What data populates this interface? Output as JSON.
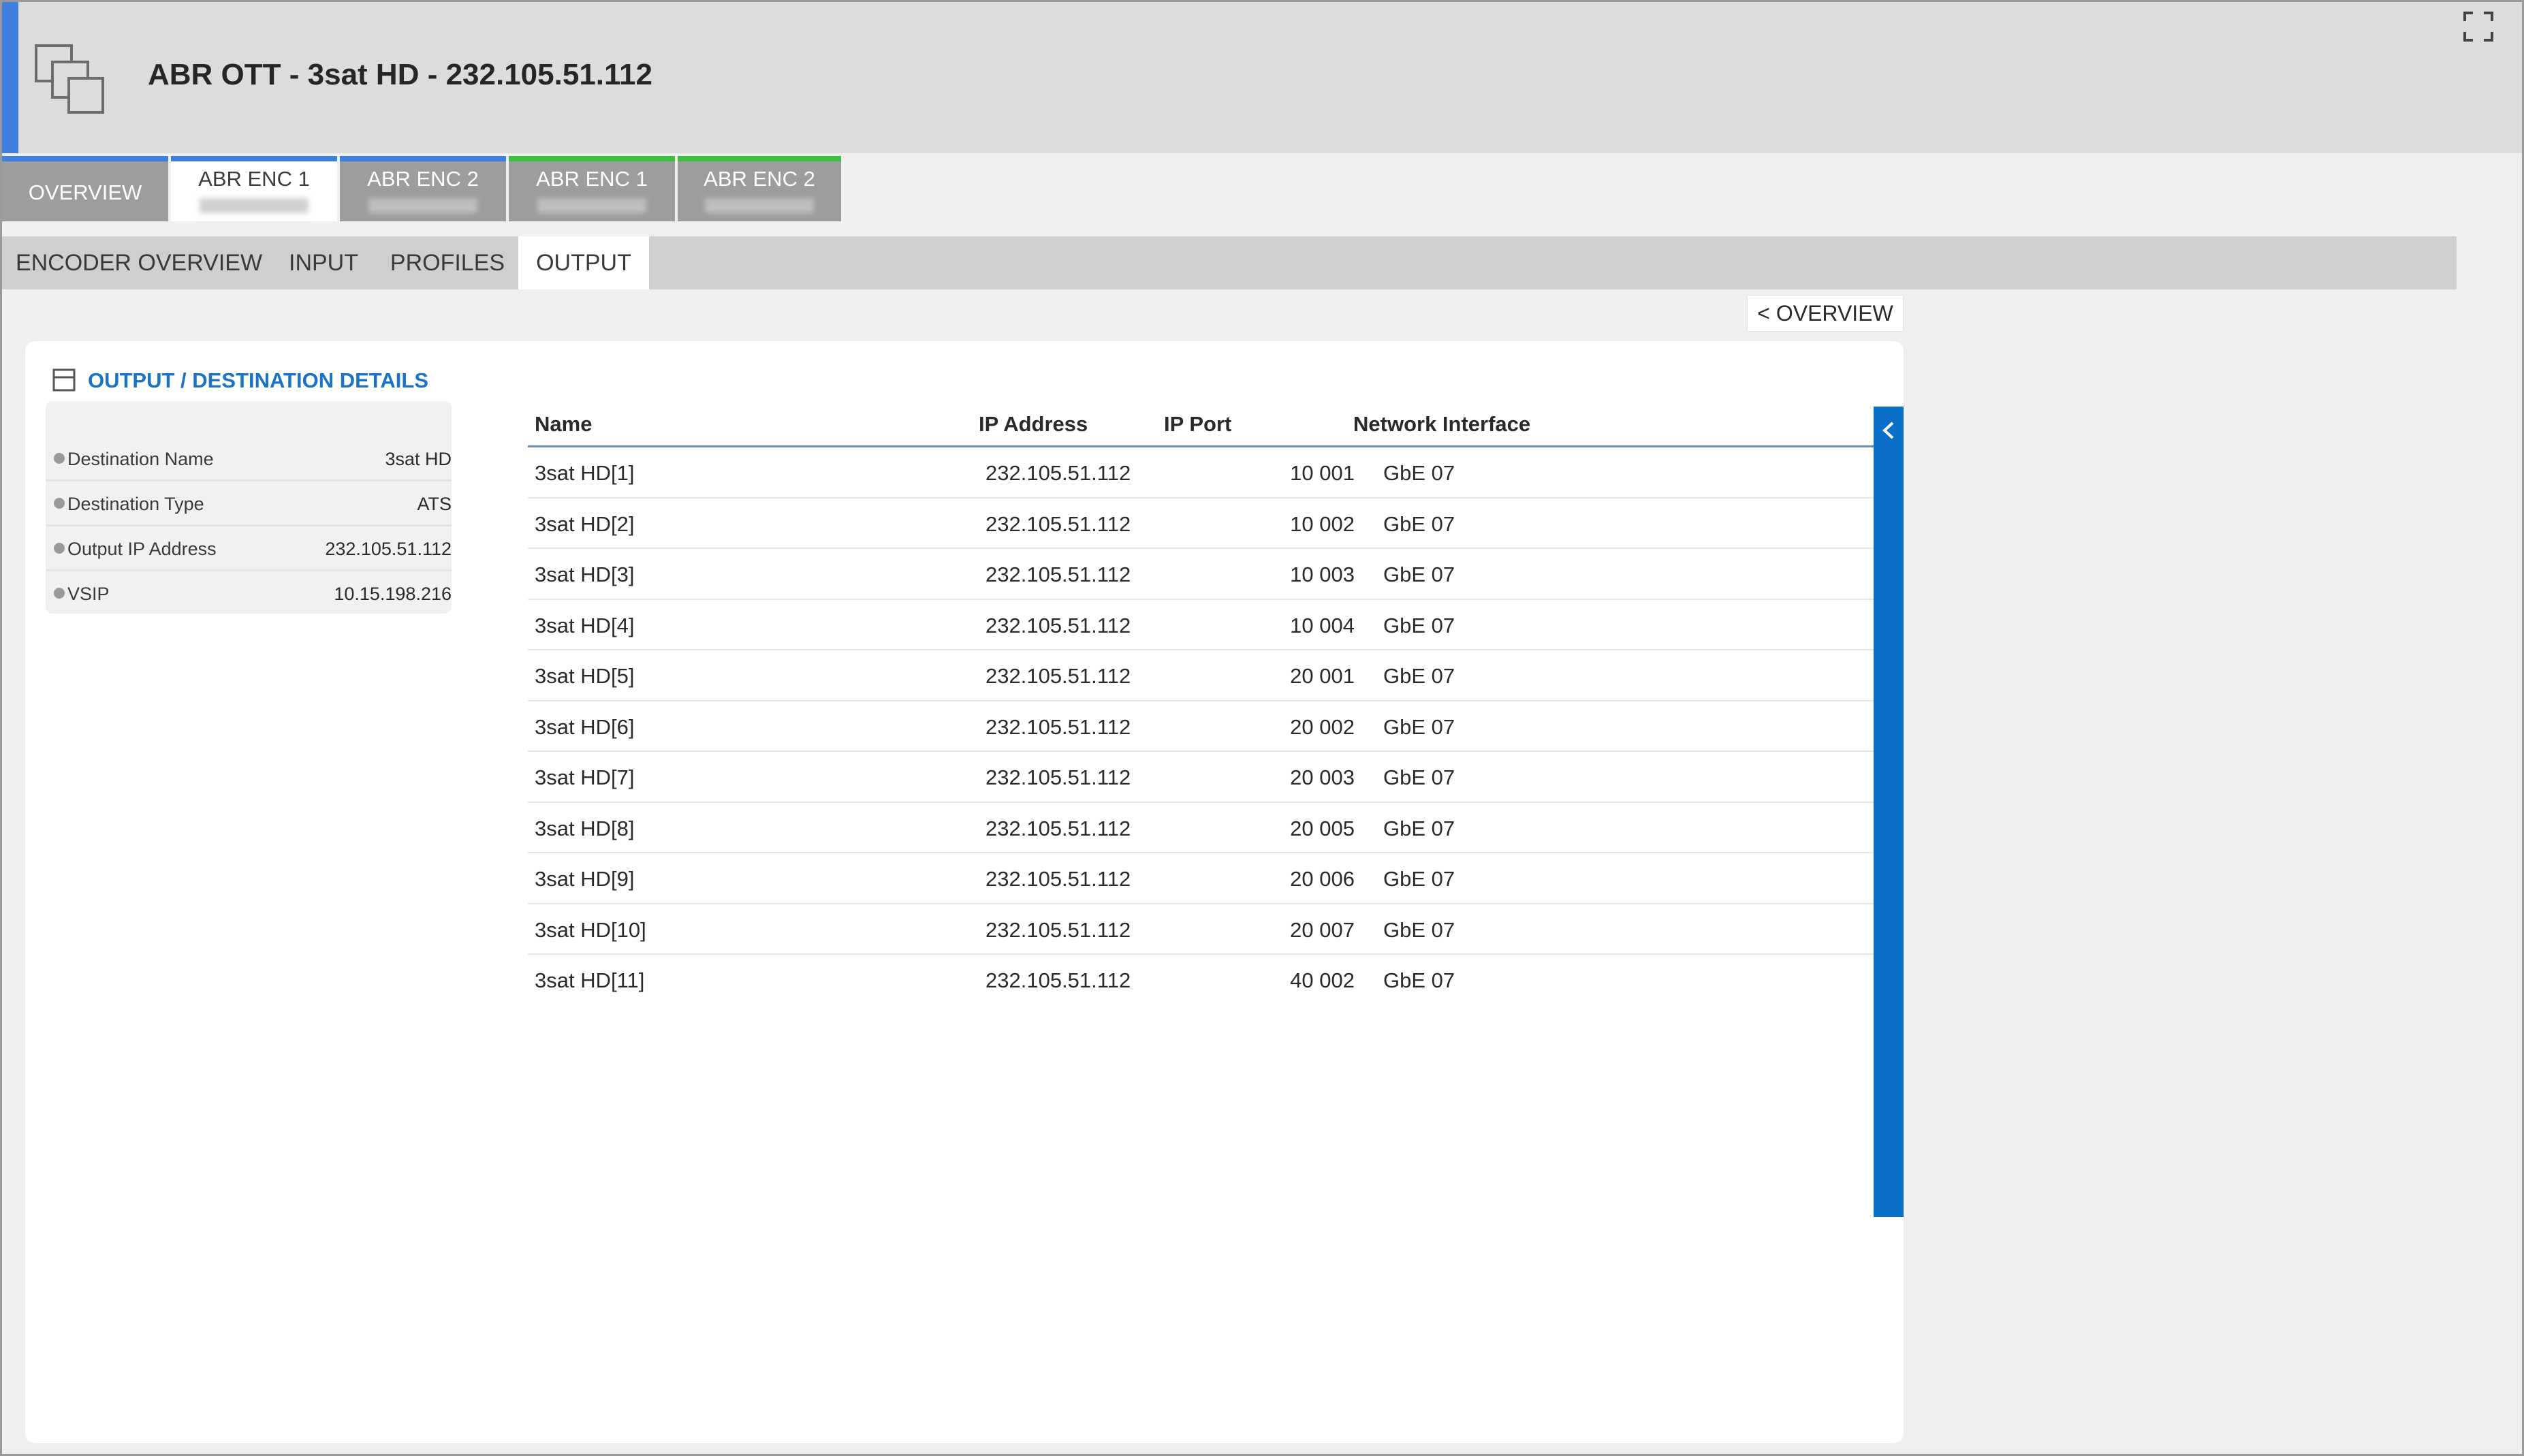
{
  "header": {
    "title": "ABR OTT - 3sat HD - 232.105.51.112",
    "icon": "node-group-icon",
    "expand_icon": "fullscreen-icon",
    "accent_color": "#3f7fe0"
  },
  "encoder_tabs": [
    {
      "label": "OVERVIEW",
      "status_color": "#3f7fe0",
      "active": false
    },
    {
      "label": "ABR ENC 1",
      "status_color": "#3f7fe0",
      "active": true
    },
    {
      "label": "ABR ENC 2",
      "status_color": "#3f7fe0",
      "active": false
    },
    {
      "label": "ABR ENC 1",
      "status_color": "#3fbf3f",
      "active": false
    },
    {
      "label": "ABR ENC 2",
      "status_color": "#3fbf3f",
      "active": false
    }
  ],
  "sub_tabs": [
    {
      "label": "ENCODER OVERVIEW",
      "active": false
    },
    {
      "label": "INPUT",
      "active": false
    },
    {
      "label": "PROFILES",
      "active": false
    },
    {
      "label": "OUTPUT",
      "active": true
    }
  ],
  "back_button": {
    "label": "< OVERVIEW"
  },
  "section": {
    "title": "OUTPUT / DESTINATION DETAILS",
    "icon": "collapse-icon",
    "title_color": "#1a73c6"
  },
  "properties": [
    {
      "key": "Destination Name",
      "value": "3sat HD"
    },
    {
      "key": "Destination Type",
      "value": "ATS"
    },
    {
      "key": "Output IP Address",
      "value": "232.105.51.112"
    },
    {
      "key": "VSIP",
      "value": "10.15.198.216"
    }
  ],
  "table": {
    "columns": {
      "name": "Name",
      "ip": "IP Address",
      "port": "IP Port",
      "net": "Network Interface"
    },
    "rows": [
      {
        "name": "3sat HD[1]",
        "ip": "232.105.51.112",
        "port": "10 001",
        "net": "GbE 07"
      },
      {
        "name": "3sat HD[2]",
        "ip": "232.105.51.112",
        "port": "10 002",
        "net": "GbE 07"
      },
      {
        "name": "3sat HD[3]",
        "ip": "232.105.51.112",
        "port": "10 003",
        "net": "GbE 07"
      },
      {
        "name": "3sat HD[4]",
        "ip": "232.105.51.112",
        "port": "10 004",
        "net": "GbE 07"
      },
      {
        "name": "3sat HD[5]",
        "ip": "232.105.51.112",
        "port": "20 001",
        "net": "GbE 07"
      },
      {
        "name": "3sat HD[6]",
        "ip": "232.105.51.112",
        "port": "20 002",
        "net": "GbE 07"
      },
      {
        "name": "3sat HD[7]",
        "ip": "232.105.51.112",
        "port": "20 003",
        "net": "GbE 07"
      },
      {
        "name": "3sat HD[8]",
        "ip": "232.105.51.112",
        "port": "20 005",
        "net": "GbE 07"
      },
      {
        "name": "3sat HD[9]",
        "ip": "232.105.51.112",
        "port": "20 006",
        "net": "GbE 07"
      },
      {
        "name": "3sat HD[10]",
        "ip": "232.105.51.112",
        "port": "20 007",
        "net": "GbE 07"
      },
      {
        "name": "3sat HD[11]",
        "ip": "232.105.51.112",
        "port": "40 002",
        "net": "GbE 07"
      }
    ]
  },
  "side_panel": {
    "icon": "chevron-left-icon",
    "color": "#0a6fc9"
  }
}
